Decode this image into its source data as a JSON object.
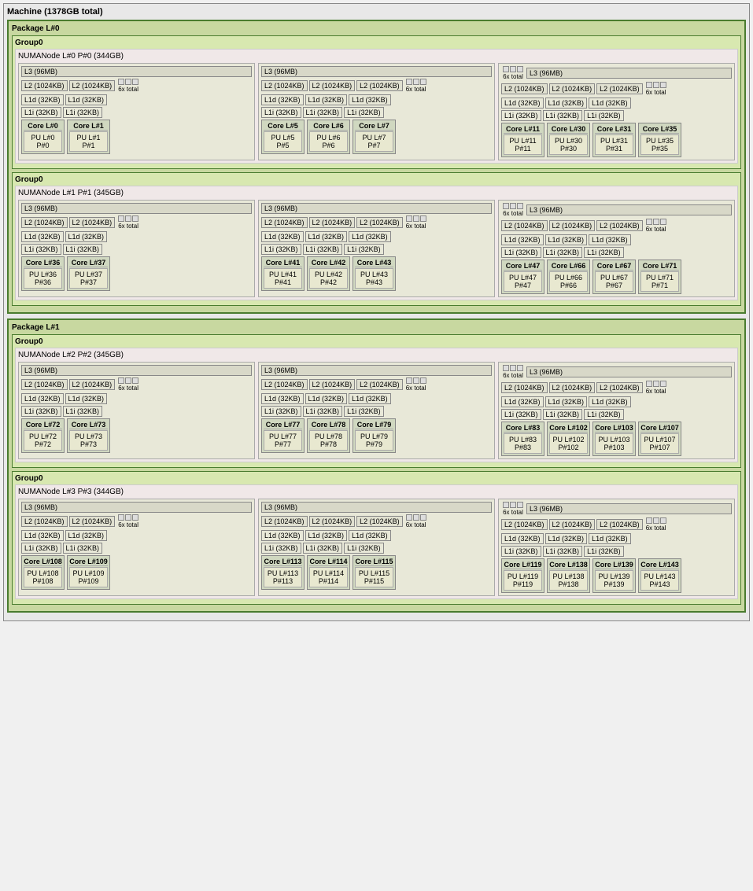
{
  "machine": {
    "title": "Machine (1378GB total)",
    "packages": [
      {
        "label": "Package L#0",
        "groups": [
          {
            "label": "Group0",
            "numa_nodes": [
              {
                "label": "NUMANode L#0 P#0 (344GB)",
                "l3_sections": [
                  {
                    "l3": "L3 (96MB)",
                    "l3_span": 1,
                    "l2_blocks": [
                      {
                        "label": "L2 (1024KB)"
                      },
                      {
                        "label": "L2 (1024KB)"
                      }
                    ],
                    "extra_badge": "6x total",
                    "l1d_blocks": [
                      {
                        "label": "L1d (32KB)"
                      },
                      {
                        "label": "L1d (32KB)"
                      }
                    ],
                    "l1i_blocks": [
                      {
                        "label": "L1i (32KB)"
                      },
                      {
                        "label": "L1i (32KB)"
                      }
                    ],
                    "cores": [
                      {
                        "core": "Core L#0",
                        "pu": "PU L#0\nP#0"
                      },
                      {
                        "core": "Core L#1",
                        "pu": "PU L#1\nP#1"
                      }
                    ]
                  },
                  {
                    "l3": "L3 (96MB)",
                    "l2_blocks": [
                      {
                        "label": "L2 (1024KB)"
                      },
                      {
                        "label": "L2 (1024KB)"
                      },
                      {
                        "label": "L2 (1024KB)"
                      }
                    ],
                    "extra_badge": "6x total",
                    "l1d_blocks": [
                      {
                        "label": "L1d (32KB)"
                      },
                      {
                        "label": "L1d (32KB)"
                      },
                      {
                        "label": "L1d (32KB)"
                      }
                    ],
                    "l1i_blocks": [
                      {
                        "label": "L1i (32KB)"
                      },
                      {
                        "label": "L1i (32KB)"
                      },
                      {
                        "label": "L1i (32KB)"
                      }
                    ],
                    "cores": [
                      {
                        "core": "Core L#5",
                        "pu": "PU L#5\nP#5"
                      },
                      {
                        "core": "Core L#6",
                        "pu": "PU L#6\nP#6"
                      },
                      {
                        "core": "Core L#7",
                        "pu": "PU L#7\nP#7"
                      }
                    ]
                  },
                  {
                    "l3": "L3 (96MB)",
                    "extra_badge_top": "6x total",
                    "l2_blocks": [
                      {
                        "label": "L2 (1024KB)"
                      },
                      {
                        "label": "L2 (1024KB)"
                      },
                      {
                        "label": "L2 (1024KB)"
                      }
                    ],
                    "extra_badge": "6x total",
                    "l1d_blocks": [
                      {
                        "label": "L1d (32KB)"
                      },
                      {
                        "label": "L1d (32KB)"
                      },
                      {
                        "label": "L1d (32KB)"
                      }
                    ],
                    "l1i_blocks": [
                      {
                        "label": "L1i (32KB)"
                      },
                      {
                        "label": "L1i (32KB)"
                      },
                      {
                        "label": "L1i (32KB)"
                      }
                    ],
                    "cores": [
                      {
                        "core": "Core L#11",
                        "pu": "PU L#11\nP#11"
                      },
                      {
                        "core": "Core L#30",
                        "pu": "PU L#30\nP#30"
                      },
                      {
                        "core": "Core L#31",
                        "pu": "PU L#31\nP#31"
                      },
                      {
                        "core": "Core L#35",
                        "pu": "PU L#35\nP#35"
                      }
                    ]
                  }
                ]
              }
            ]
          },
          {
            "label": "Group0",
            "numa_nodes": [
              {
                "label": "NUMANode L#1 P#1 (345GB)",
                "l3_sections": [
                  {
                    "l3": "L3 (96MB)",
                    "l2_blocks": [
                      {
                        "label": "L2 (1024KB)"
                      },
                      {
                        "label": "L2 (1024KB)"
                      }
                    ],
                    "extra_badge": "6x total",
                    "l1d_blocks": [
                      {
                        "label": "L1d (32KB)"
                      },
                      {
                        "label": "L1d (32KB)"
                      }
                    ],
                    "l1i_blocks": [
                      {
                        "label": "L1i (32KB)"
                      },
                      {
                        "label": "L1i (32KB)"
                      }
                    ],
                    "cores": [
                      {
                        "core": "Core L#36",
                        "pu": "PU L#36\nP#36"
                      },
                      {
                        "core": "Core L#37",
                        "pu": "PU L#37\nP#37"
                      }
                    ]
                  },
                  {
                    "l3": "L3 (96MB)",
                    "l2_blocks": [
                      {
                        "label": "L2 (1024KB)"
                      },
                      {
                        "label": "L2 (1024KB)"
                      },
                      {
                        "label": "L2 (1024KB)"
                      }
                    ],
                    "extra_badge": "6x total",
                    "l1d_blocks": [
                      {
                        "label": "L1d (32KB)"
                      },
                      {
                        "label": "L1d (32KB)"
                      },
                      {
                        "label": "L1d (32KB)"
                      }
                    ],
                    "l1i_blocks": [
                      {
                        "label": "L1i (32KB)"
                      },
                      {
                        "label": "L1i (32KB)"
                      },
                      {
                        "label": "L1i (32KB)"
                      }
                    ],
                    "cores": [
                      {
                        "core": "Core L#41",
                        "pu": "PU L#41\nP#41"
                      },
                      {
                        "core": "Core L#42",
                        "pu": "PU L#42\nP#42"
                      },
                      {
                        "core": "Core L#43",
                        "pu": "PU L#43\nP#43"
                      }
                    ]
                  },
                  {
                    "l3": "L3 (96MB)",
                    "extra_badge_top": "6x total",
                    "l2_blocks": [
                      {
                        "label": "L2 (1024KB)"
                      },
                      {
                        "label": "L2 (1024KB)"
                      },
                      {
                        "label": "L2 (1024KB)"
                      }
                    ],
                    "extra_badge": "6x total",
                    "l1d_blocks": [
                      {
                        "label": "L1d (32KB)"
                      },
                      {
                        "label": "L1d (32KB)"
                      },
                      {
                        "label": "L1d (32KB)"
                      }
                    ],
                    "l1i_blocks": [
                      {
                        "label": "L1i (32KB)"
                      },
                      {
                        "label": "L1i (32KB)"
                      },
                      {
                        "label": "L1i (32KB)"
                      }
                    ],
                    "cores": [
                      {
                        "core": "Core L#47",
                        "pu": "PU L#47\nP#47"
                      },
                      {
                        "core": "Core L#66",
                        "pu": "PU L#66\nP#66"
                      },
                      {
                        "core": "Core L#67",
                        "pu": "PU L#67\nP#67"
                      },
                      {
                        "core": "Core L#71",
                        "pu": "PU L#71\nP#71"
                      }
                    ]
                  }
                ]
              }
            ]
          }
        ]
      },
      {
        "label": "Package L#1",
        "groups": [
          {
            "label": "Group0",
            "numa_nodes": [
              {
                "label": "NUMANode L#2 P#2 (345GB)",
                "l3_sections": [
                  {
                    "l3": "L3 (96MB)",
                    "l2_blocks": [
                      {
                        "label": "L2 (1024KB)"
                      },
                      {
                        "label": "L2 (1024KB)"
                      }
                    ],
                    "extra_badge": "6x total",
                    "l1d_blocks": [
                      {
                        "label": "L1d (32KB)"
                      },
                      {
                        "label": "L1d (32KB)"
                      }
                    ],
                    "l1i_blocks": [
                      {
                        "label": "L1i (32KB)"
                      },
                      {
                        "label": "L1i (32KB)"
                      }
                    ],
                    "cores": [
                      {
                        "core": "Core L#72",
                        "pu": "PU L#72\nP#72"
                      },
                      {
                        "core": "Core L#73",
                        "pu": "PU L#73\nP#73"
                      }
                    ]
                  },
                  {
                    "l3": "L3 (96MB)",
                    "l2_blocks": [
                      {
                        "label": "L2 (1024KB)"
                      },
                      {
                        "label": "L2 (1024KB)"
                      },
                      {
                        "label": "L2 (1024KB)"
                      }
                    ],
                    "extra_badge": "6x total",
                    "l1d_blocks": [
                      {
                        "label": "L1d (32KB)"
                      },
                      {
                        "label": "L1d (32KB)"
                      },
                      {
                        "label": "L1d (32KB)"
                      }
                    ],
                    "l1i_blocks": [
                      {
                        "label": "L1i (32KB)"
                      },
                      {
                        "label": "L1i (32KB)"
                      },
                      {
                        "label": "L1i (32KB)"
                      }
                    ],
                    "cores": [
                      {
                        "core": "Core L#77",
                        "pu": "PU L#77\nP#77"
                      },
                      {
                        "core": "Core L#78",
                        "pu": "PU L#78\nP#78"
                      },
                      {
                        "core": "Core L#79",
                        "pu": "PU L#79\nP#79"
                      }
                    ]
                  },
                  {
                    "l3": "L3 (96MB)",
                    "extra_badge_top": "6x total",
                    "l2_blocks": [
                      {
                        "label": "L2 (1024KB)"
                      },
                      {
                        "label": "L2 (1024KB)"
                      },
                      {
                        "label": "L2 (1024KB)"
                      }
                    ],
                    "extra_badge": "6x total",
                    "l1d_blocks": [
                      {
                        "label": "L1d (32KB)"
                      },
                      {
                        "label": "L1d (32KB)"
                      },
                      {
                        "label": "L1d (32KB)"
                      }
                    ],
                    "l1i_blocks": [
                      {
                        "label": "L1i (32KB)"
                      },
                      {
                        "label": "L1i (32KB)"
                      },
                      {
                        "label": "L1i (32KB)"
                      }
                    ],
                    "cores": [
                      {
                        "core": "Core L#83",
                        "pu": "PU L#83\nP#83"
                      },
                      {
                        "core": "Core L#102",
                        "pu": "PU L#102\nP#102"
                      },
                      {
                        "core": "Core L#103",
                        "pu": "PU L#103\nP#103"
                      },
                      {
                        "core": "Core L#107",
                        "pu": "PU L#107\nP#107"
                      }
                    ]
                  }
                ]
              }
            ]
          },
          {
            "label": "Group0",
            "numa_nodes": [
              {
                "label": "NUMANode L#3 P#3 (344GB)",
                "l3_sections": [
                  {
                    "l3": "L3 (96MB)",
                    "l2_blocks": [
                      {
                        "label": "L2 (1024KB)"
                      },
                      {
                        "label": "L2 (1024KB)"
                      }
                    ],
                    "extra_badge": "6x total",
                    "l1d_blocks": [
                      {
                        "label": "L1d (32KB)"
                      },
                      {
                        "label": "L1d (32KB)"
                      }
                    ],
                    "l1i_blocks": [
                      {
                        "label": "L1i (32KB)"
                      },
                      {
                        "label": "L1i (32KB)"
                      }
                    ],
                    "cores": [
                      {
                        "core": "Core L#108",
                        "pu": "PU L#108\nP#108"
                      },
                      {
                        "core": "Core L#109",
                        "pu": "PU L#109\nP#109"
                      }
                    ]
                  },
                  {
                    "l3": "L3 (96MB)",
                    "l2_blocks": [
                      {
                        "label": "L2 (1024KB)"
                      },
                      {
                        "label": "L2 (1024KB)"
                      },
                      {
                        "label": "L2 (1024KB)"
                      }
                    ],
                    "extra_badge": "6x total",
                    "l1d_blocks": [
                      {
                        "label": "L1d (32KB)"
                      },
                      {
                        "label": "L1d (32KB)"
                      },
                      {
                        "label": "L1d (32KB)"
                      }
                    ],
                    "l1i_blocks": [
                      {
                        "label": "L1i (32KB)"
                      },
                      {
                        "label": "L1i (32KB)"
                      },
                      {
                        "label": "L1i (32KB)"
                      }
                    ],
                    "cores": [
                      {
                        "core": "Core L#113",
                        "pu": "PU L#113\nP#113"
                      },
                      {
                        "core": "Core L#114",
                        "pu": "PU L#114\nP#114"
                      },
                      {
                        "core": "Core L#115",
                        "pu": "PU L#115\nP#115"
                      }
                    ]
                  },
                  {
                    "l3": "L3 (96MB)",
                    "extra_badge_top": "6x total",
                    "l2_blocks": [
                      {
                        "label": "L2 (1024KB)"
                      },
                      {
                        "label": "L2 (1024KB)"
                      },
                      {
                        "label": "L2 (1024KB)"
                      }
                    ],
                    "extra_badge": "6x total",
                    "l1d_blocks": [
                      {
                        "label": "L1d (32KB)"
                      },
                      {
                        "label": "L1d (32KB)"
                      },
                      {
                        "label": "L1d (32KB)"
                      }
                    ],
                    "l1i_blocks": [
                      {
                        "label": "L1i (32KB)"
                      },
                      {
                        "label": "L1i (32KB)"
                      },
                      {
                        "label": "L1i (32KB)"
                      }
                    ],
                    "cores": [
                      {
                        "core": "Core L#119",
                        "pu": "PU L#119\nP#119"
                      },
                      {
                        "core": "Core L#138",
                        "pu": "PU L#138\nP#138"
                      },
                      {
                        "core": "Core L#139",
                        "pu": "PU L#139\nP#139"
                      },
                      {
                        "core": "Core L#143",
                        "pu": "PU L#143\nP#143"
                      }
                    ]
                  }
                ]
              }
            ]
          }
        ]
      }
    ]
  }
}
